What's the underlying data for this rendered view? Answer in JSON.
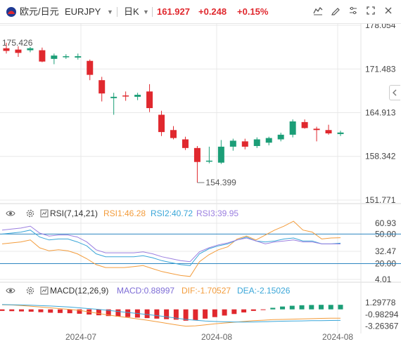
{
  "header": {
    "pair_label": "欧元/日元",
    "symbol": "EURJPY",
    "timeframe": "日K",
    "price": "161.927",
    "change": "+0.248",
    "change_pct": "+0.15%"
  },
  "colors": {
    "up": "#e0282e",
    "down": "#1b9e77",
    "rsi1": "#f39c3c",
    "rsi2": "#3aa6d8",
    "rsi3": "#9b7fe0",
    "macd": "#7e6dd6",
    "dif": "#f39c3c",
    "dea": "#3aa6d8",
    "grid": "#e8e8e8",
    "line_guide": "#2e86c1"
  },
  "chart_data": [
    {
      "type": "candlestick",
      "name": "price",
      "y_axis_ticks": [
        "178.054",
        "171.483",
        "164.913",
        "158.342",
        "151.771"
      ],
      "ylim": [
        151.771,
        178.054
      ],
      "x_axis_ticks": [
        "2024-07",
        "2024-08",
        "2024-08"
      ],
      "high_annotation": "175.426",
      "low_annotation": "154.399",
      "candles": [
        {
          "o": 174.6,
          "h": 175.426,
          "l": 173.8,
          "c": 174.2
        },
        {
          "o": 174.4,
          "h": 174.9,
          "l": 173.3,
          "c": 173.9
        },
        {
          "o": 174.3,
          "h": 174.8,
          "l": 174.0,
          "c": 174.6
        },
        {
          "o": 174.3,
          "h": 174.7,
          "l": 172.5,
          "c": 172.6
        },
        {
          "o": 173.0,
          "h": 173.8,
          "l": 172.2,
          "c": 173.5
        },
        {
          "o": 173.4,
          "h": 173.7,
          "l": 173.0,
          "c": 173.4
        },
        {
          "o": 173.2,
          "h": 173.8,
          "l": 172.9,
          "c": 173.4
        },
        {
          "o": 172.7,
          "h": 172.9,
          "l": 169.8,
          "c": 170.6
        },
        {
          "o": 169.8,
          "h": 170.3,
          "l": 166.6,
          "c": 167.8
        },
        {
          "o": 167.1,
          "h": 167.9,
          "l": 164.6,
          "c": 167.3
        },
        {
          "o": 167.5,
          "h": 168.1,
          "l": 166.7,
          "c": 167.4
        },
        {
          "o": 167.3,
          "h": 167.9,
          "l": 166.8,
          "c": 167.6
        },
        {
          "o": 168.1,
          "h": 169.2,
          "l": 165.0,
          "c": 165.6
        },
        {
          "o": 164.6,
          "h": 165.2,
          "l": 161.4,
          "c": 162.0
        },
        {
          "o": 162.3,
          "h": 162.9,
          "l": 160.9,
          "c": 161.1
        },
        {
          "o": 160.9,
          "h": 161.3,
          "l": 159.3,
          "c": 159.6
        },
        {
          "o": 159.6,
          "h": 159.9,
          "l": 154.399,
          "c": 157.5
        },
        {
          "o": 157.6,
          "h": 159.8,
          "l": 157.3,
          "c": 157.7
        },
        {
          "o": 157.4,
          "h": 160.8,
          "l": 157.2,
          "c": 159.8
        },
        {
          "o": 159.8,
          "h": 161.0,
          "l": 159.2,
          "c": 160.7
        },
        {
          "o": 160.6,
          "h": 161.0,
          "l": 159.4,
          "c": 159.8
        },
        {
          "o": 159.9,
          "h": 161.2,
          "l": 159.6,
          "c": 160.9
        },
        {
          "o": 160.4,
          "h": 161.3,
          "l": 160.0,
          "c": 161.1
        },
        {
          "o": 160.9,
          "h": 161.9,
          "l": 160.6,
          "c": 161.6
        },
        {
          "o": 161.6,
          "h": 163.9,
          "l": 161.2,
          "c": 163.6
        },
        {
          "o": 163.5,
          "h": 163.9,
          "l": 162.5,
          "c": 162.6
        },
        {
          "o": 162.5,
          "h": 162.8,
          "l": 160.6,
          "c": 162.3
        },
        {
          "o": 162.3,
          "h": 163.1,
          "l": 161.6,
          "c": 161.8
        },
        {
          "o": 161.7,
          "h": 162.2,
          "l": 161.4,
          "c": 161.927
        }
      ]
    },
    {
      "type": "line",
      "name": "RSI",
      "indicator_label": "RSI(7,14,21)",
      "y_axis_ticks": [
        "60.93",
        "50.00",
        "32.47",
        "20.00",
        "4.01"
      ],
      "ylim": [
        4.01,
        60.93
      ],
      "guides": [
        50,
        20
      ],
      "series": [
        {
          "name": "RSI1:46.28",
          "values": [
            40,
            41,
            42,
            44,
            36,
            33,
            34,
            33,
            30,
            25,
            19,
            16,
            16,
            16,
            17,
            18,
            15,
            12,
            10,
            8,
            7,
            22,
            29,
            34,
            37,
            45,
            48,
            44,
            49,
            54,
            58,
            63,
            54,
            52,
            45,
            46,
            46.28
          ]
        },
        {
          "name": "RSI2:40.72",
          "values": [
            50,
            51,
            52,
            54,
            47,
            44,
            45,
            45,
            42,
            38,
            30,
            27,
            27,
            27,
            27,
            28,
            26,
            23,
            21,
            19,
            18,
            30,
            35,
            38,
            40,
            44,
            47,
            43,
            42,
            43,
            45,
            46,
            43,
            43,
            40,
            40,
            40.72
          ]
        },
        {
          "name": "RSI3:39.95",
          "values": [
            54,
            55,
            56,
            58,
            51,
            48,
            49,
            49,
            47,
            42,
            34,
            31,
            31,
            31,
            31,
            32,
            30,
            27,
            25,
            23,
            22,
            32,
            36,
            39,
            41,
            44,
            46,
            43,
            40,
            42,
            43,
            44,
            42,
            42,
            40,
            40,
            39.95
          ]
        }
      ]
    },
    {
      "type": "bar+line",
      "name": "MACD",
      "indicator_label": "MACD(12,26,9)",
      "y_axis_ticks": [
        "1.29778",
        "-0.98294",
        "-3.26367"
      ],
      "ylim": [
        -4.0,
        2.0
      ],
      "series": [
        {
          "name": "MACD:0.88997",
          "values": [
            -0.3,
            -0.35,
            -0.4,
            -0.45,
            -0.55,
            -0.65,
            -0.7,
            -0.75,
            -0.85,
            -1.0,
            -1.15,
            -1.3,
            -1.4,
            -1.5,
            -1.6,
            -1.7,
            -1.8,
            -1.9,
            -2.0,
            -2.2,
            -2.1,
            -1.8,
            -1.5,
            -1.2,
            -0.9,
            -0.6,
            -0.3,
            -0.05,
            0.3,
            0.55,
            0.7,
            0.8,
            0.85,
            0.88,
            0.87,
            0.88997
          ]
        },
        {
          "name": "DIF:-1.70527",
          "values": [
            0.9,
            0.85,
            0.75,
            0.6,
            0.45,
            0.3,
            0.15,
            0.0,
            -0.2,
            -0.5,
            -0.8,
            -1.1,
            -1.35,
            -1.6,
            -1.85,
            -2.1,
            -2.4,
            -2.7,
            -3.0,
            -3.26,
            -3.2,
            -3.0,
            -2.8,
            -2.65,
            -2.5,
            -2.35,
            -2.2,
            -2.1,
            -2.0,
            -1.95,
            -1.9,
            -1.85,
            -1.8,
            -1.75,
            -1.72,
            -1.70527
          ]
        },
        {
          "name": "DEA:-2.15026",
          "values": [
            0.95,
            0.9,
            0.85,
            0.8,
            0.72,
            0.65,
            0.55,
            0.45,
            0.3,
            0.15,
            0.0,
            -0.2,
            -0.4,
            -0.6,
            -0.8,
            -1.0,
            -1.2,
            -1.45,
            -1.7,
            -1.95,
            -2.1,
            -2.25,
            -2.35,
            -2.42,
            -2.45,
            -2.47,
            -2.45,
            -2.4,
            -2.35,
            -2.3,
            -2.27,
            -2.24,
            -2.2,
            -2.18,
            -2.16,
            -2.15026
          ]
        }
      ]
    }
  ]
}
